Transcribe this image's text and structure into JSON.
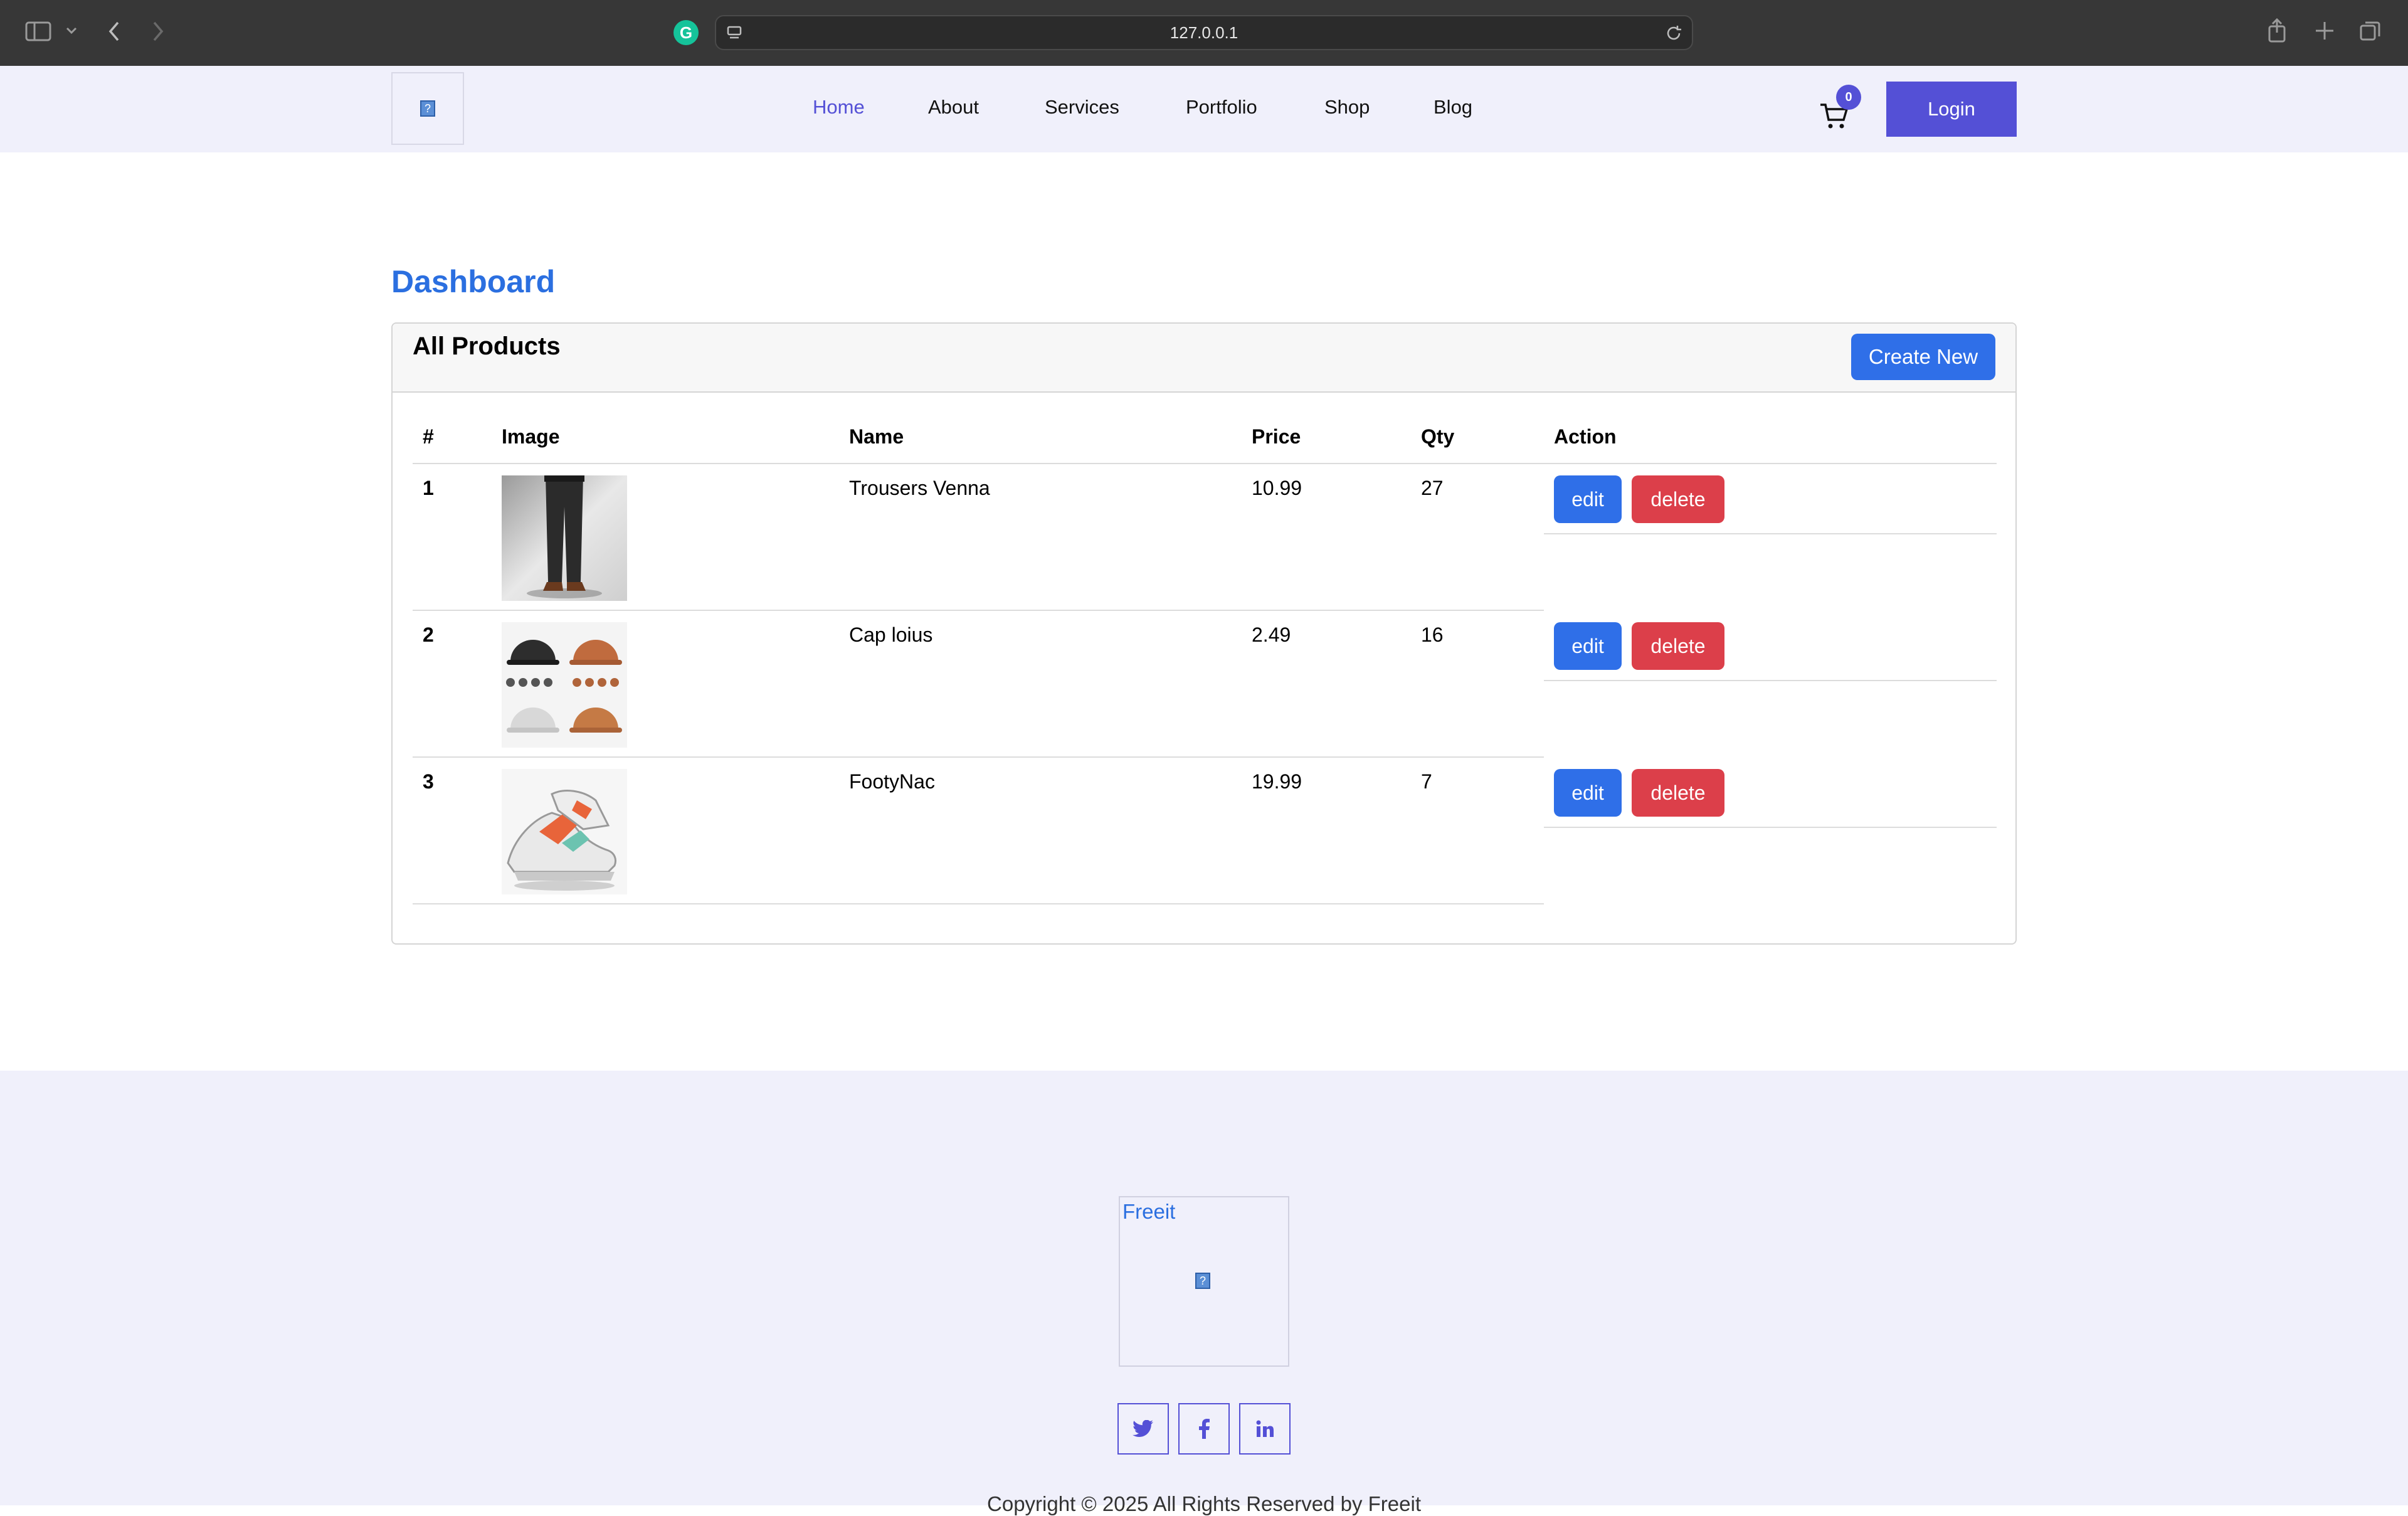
{
  "browser": {
    "url": "127.0.0.1",
    "icons": [
      "sidebar-icon",
      "chevron-down-icon",
      "back-icon",
      "forward-icon",
      "grammarly-icon",
      "site-settings-icon",
      "reload-icon",
      "share-icon",
      "new-tab-icon",
      "tabs-overview-icon"
    ]
  },
  "header": {
    "logo_alt": "?",
    "nav": [
      "Home",
      "About",
      "Services",
      "Portfolio",
      "Shop",
      "Blog"
    ],
    "active_nav": "Home",
    "cart_count": "0",
    "login_label": "Login"
  },
  "main": {
    "title": "Dashboard",
    "card_title": "All Products",
    "create_label": "Create New",
    "columns": [
      "#",
      "Image",
      "Name",
      "Price",
      "Qty",
      "Action"
    ],
    "rows": [
      {
        "num": "1",
        "name": "Trousers Venna",
        "price": "10.99",
        "qty": "27",
        "image": "trousers-image"
      },
      {
        "num": "2",
        "name": "Cap loius",
        "price": "2.49",
        "qty": "16",
        "image": "caps-image"
      },
      {
        "num": "3",
        "name": "FootyNac",
        "price": "19.99",
        "qty": "7",
        "image": "sneakers-image"
      }
    ],
    "edit_label": "edit",
    "delete_label": "delete"
  },
  "footer": {
    "logo_alt": "Freeit",
    "social": [
      "twitter-icon",
      "facebook-icon",
      "linkedin-icon"
    ],
    "copyright": "Copyright © 2025 All Rights Reserved by Freeit"
  },
  "colors": {
    "accent": "#5450d6",
    "primary_button": "#2f6fe8",
    "danger_button": "#dc3f4a",
    "header_bg": "#f0f0fb",
    "title_blue": "#2b6fe0"
  }
}
